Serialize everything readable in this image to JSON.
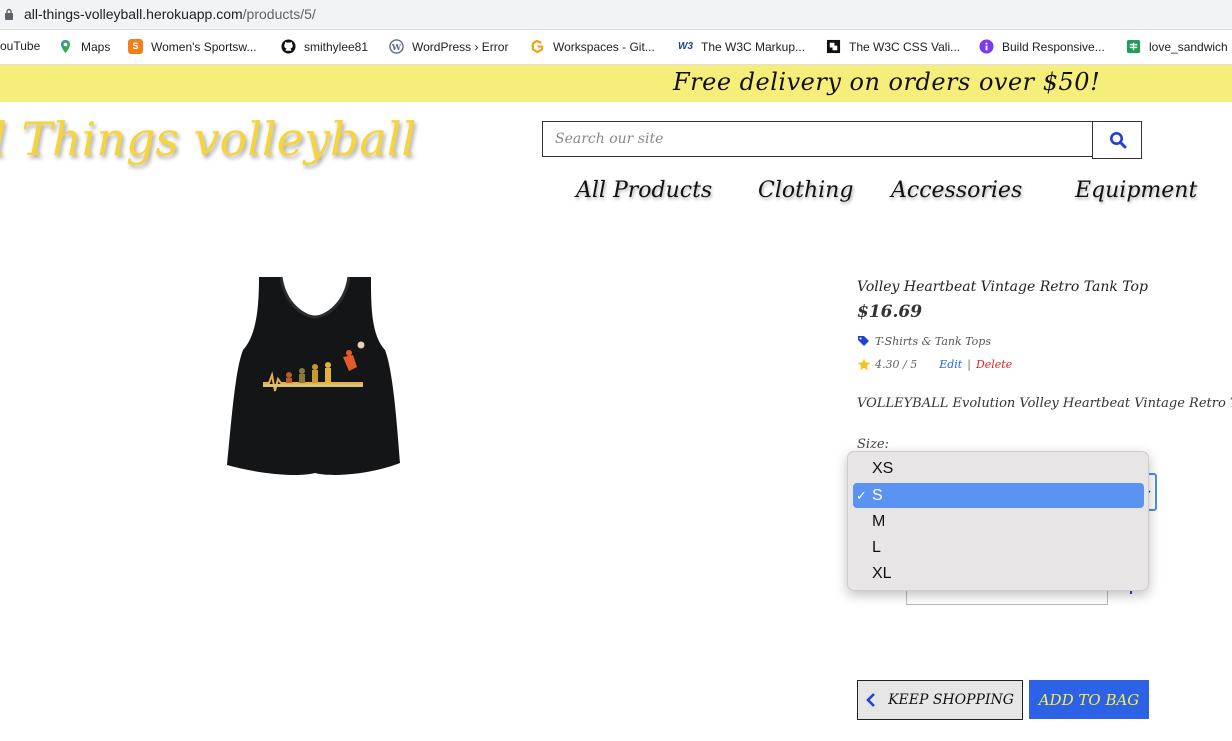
{
  "browser": {
    "url_host": "all-things-volleyball.herokuapp.com",
    "url_path": "/products/5/"
  },
  "bookmarks": [
    {
      "label": "ouTube",
      "icon": "youtube-icon"
    },
    {
      "label": "Maps",
      "icon": "maps-pin-icon"
    },
    {
      "label": "Women's Sportsw...",
      "icon": "sportswear-s-icon"
    },
    {
      "label": "smithylee81",
      "icon": "github-icon"
    },
    {
      "label": "WordPress › Error",
      "icon": "wordpress-icon"
    },
    {
      "label": "Workspaces - Git...",
      "icon": "gitpod-icon"
    },
    {
      "label": "The W3C Markup...",
      "icon": "w3c-icon"
    },
    {
      "label": "The W3C CSS Vali...",
      "icon": "w3c-css-icon"
    },
    {
      "label": "Build Responsive...",
      "icon": "info-icon"
    },
    {
      "label": "love_sandwich",
      "icon": "sheets-icon"
    }
  ],
  "promo": {
    "text": "Free delivery on orders over $50!"
  },
  "site": {
    "logo": "l Things volleyball"
  },
  "search": {
    "placeholder": "Search our site"
  },
  "nav": [
    "All Products",
    "Clothing",
    "Accessories",
    "Equipment"
  ],
  "product": {
    "title": "Volley Heartbeat Vintage Retro Tank Top",
    "price": "$16.69",
    "category": "T-Shirts & Tank Tops",
    "rating": "4.30 / 5",
    "edit": "Edit",
    "separator": "|",
    "delete": "Delete",
    "description": "VOLLEYBALL Evolution Volley Heartbeat Vintage Retro Tank",
    "size_label": "Size:"
  },
  "size_select": {
    "options": [
      "XS",
      "S",
      "M",
      "L",
      "XL"
    ],
    "selected": "S"
  },
  "buttons": {
    "keep_shopping": "KEEP SHOPPING",
    "add_to_bag": "ADD TO BAG"
  },
  "colors": {
    "promo_bg": "#f6ee7a",
    "logo": "#f6d43a",
    "accent_blue": "#2d62e6",
    "delete_red": "#dc2626"
  }
}
